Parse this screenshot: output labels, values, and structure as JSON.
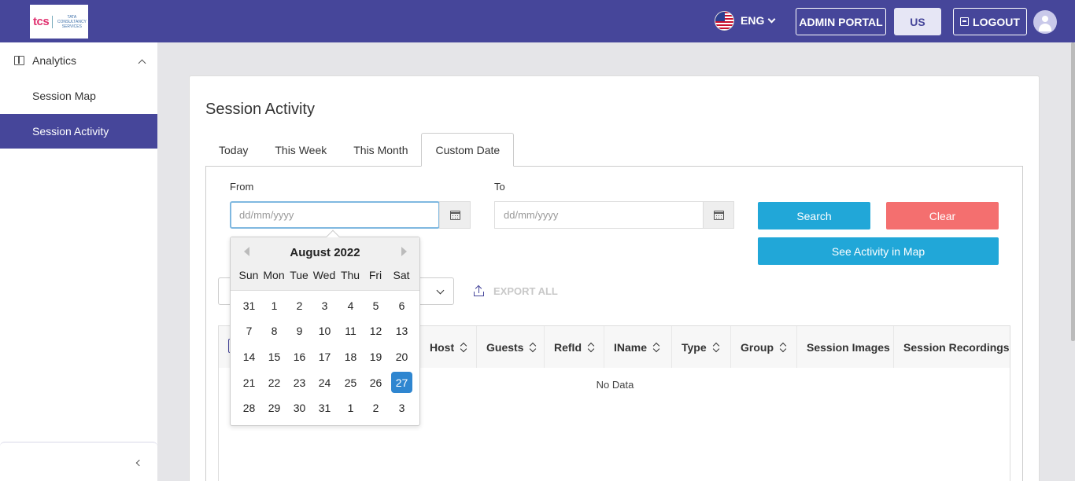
{
  "header": {
    "logo_text": "tcs",
    "logo_subtext": "TATA CONSULTANCY SERVICES",
    "language": "ENG",
    "admin_portal": "ADMIN PORTAL",
    "region": "US",
    "logout": "LOGOUT"
  },
  "sidebar": {
    "items": [
      {
        "label": "Analytics"
      },
      {
        "label": "Session Map"
      },
      {
        "label": "Session Activity"
      }
    ]
  },
  "main": {
    "title": "Session Activity",
    "tabs": [
      {
        "label": "Today"
      },
      {
        "label": "This Week"
      },
      {
        "label": "This Month"
      },
      {
        "label": "Custom Date"
      }
    ],
    "active_tab": "Custom Date",
    "from_label": "From",
    "to_label": "To",
    "from_placeholder": "dd/mm/yyyy",
    "to_placeholder": "dd/mm/yyyy",
    "search_label": "Search",
    "clear_label": "Clear",
    "map_label": "See Activity in Map",
    "export_label": "EXPORT ALL",
    "no_data": "No Data"
  },
  "table": {
    "columns": [
      "Host",
      "Guests",
      "RefId",
      "IName",
      "Type",
      "Group",
      "Session Images",
      "Session Recordings"
    ]
  },
  "datepicker": {
    "title": "August 2022",
    "weekdays": [
      "Sun",
      "Mon",
      "Tue",
      "Wed",
      "Thu",
      "Fri",
      "Sat"
    ],
    "weeks": [
      [
        "31",
        "1",
        "2",
        "3",
        "4",
        "5",
        "6"
      ],
      [
        "7",
        "8",
        "9",
        "10",
        "11",
        "12",
        "13"
      ],
      [
        "14",
        "15",
        "16",
        "17",
        "18",
        "19",
        "20"
      ],
      [
        "21",
        "22",
        "23",
        "24",
        "25",
        "26",
        "27"
      ],
      [
        "28",
        "29",
        "30",
        "31",
        "1",
        "2",
        "3"
      ]
    ],
    "selected": "27"
  },
  "colors": {
    "brand": "#46469a",
    "primary_button": "#21a7d8",
    "danger_button": "#f46f6f",
    "selected_day": "#2f86d0"
  }
}
